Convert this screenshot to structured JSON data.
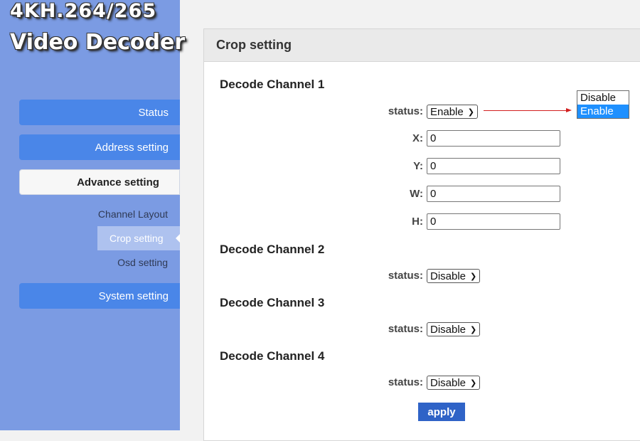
{
  "sidebar": {
    "logo_line1": "4KH.264/265",
    "logo_line2": "Video Decoder",
    "menu": {
      "status": "Status",
      "address": "Address setting",
      "advance": "Advance setting",
      "system": "System setting"
    },
    "submenu": {
      "channel_layout": "Channel Layout",
      "crop": "Crop setting",
      "osd": "Osd setting"
    }
  },
  "panel": {
    "title": "Crop setting",
    "channels": [
      {
        "title": "Decode Channel 1",
        "status_label": "status:",
        "status_value": "Enable",
        "fields": [
          {
            "label": "X:",
            "value": "0"
          },
          {
            "label": "Y:",
            "value": "0"
          },
          {
            "label": "W:",
            "value": "0"
          },
          {
            "label": "H:",
            "value": "0"
          }
        ]
      },
      {
        "title": "Decode Channel 2",
        "status_label": "status:",
        "status_value": "Disable"
      },
      {
        "title": "Decode Channel 3",
        "status_label": "status:",
        "status_value": "Disable"
      },
      {
        "title": "Decode Channel 4",
        "status_label": "status:",
        "status_value": "Disable"
      }
    ],
    "dropdown_options": [
      "Disable",
      "Enable"
    ],
    "apply_label": "apply"
  },
  "colors": {
    "sidebar_bg": "#7b9be3",
    "nav_button": "#4a86e8",
    "apply_button": "#2f63c7",
    "dropdown_highlight": "#1e90ff",
    "annotation_arrow": "#d21f1f"
  }
}
